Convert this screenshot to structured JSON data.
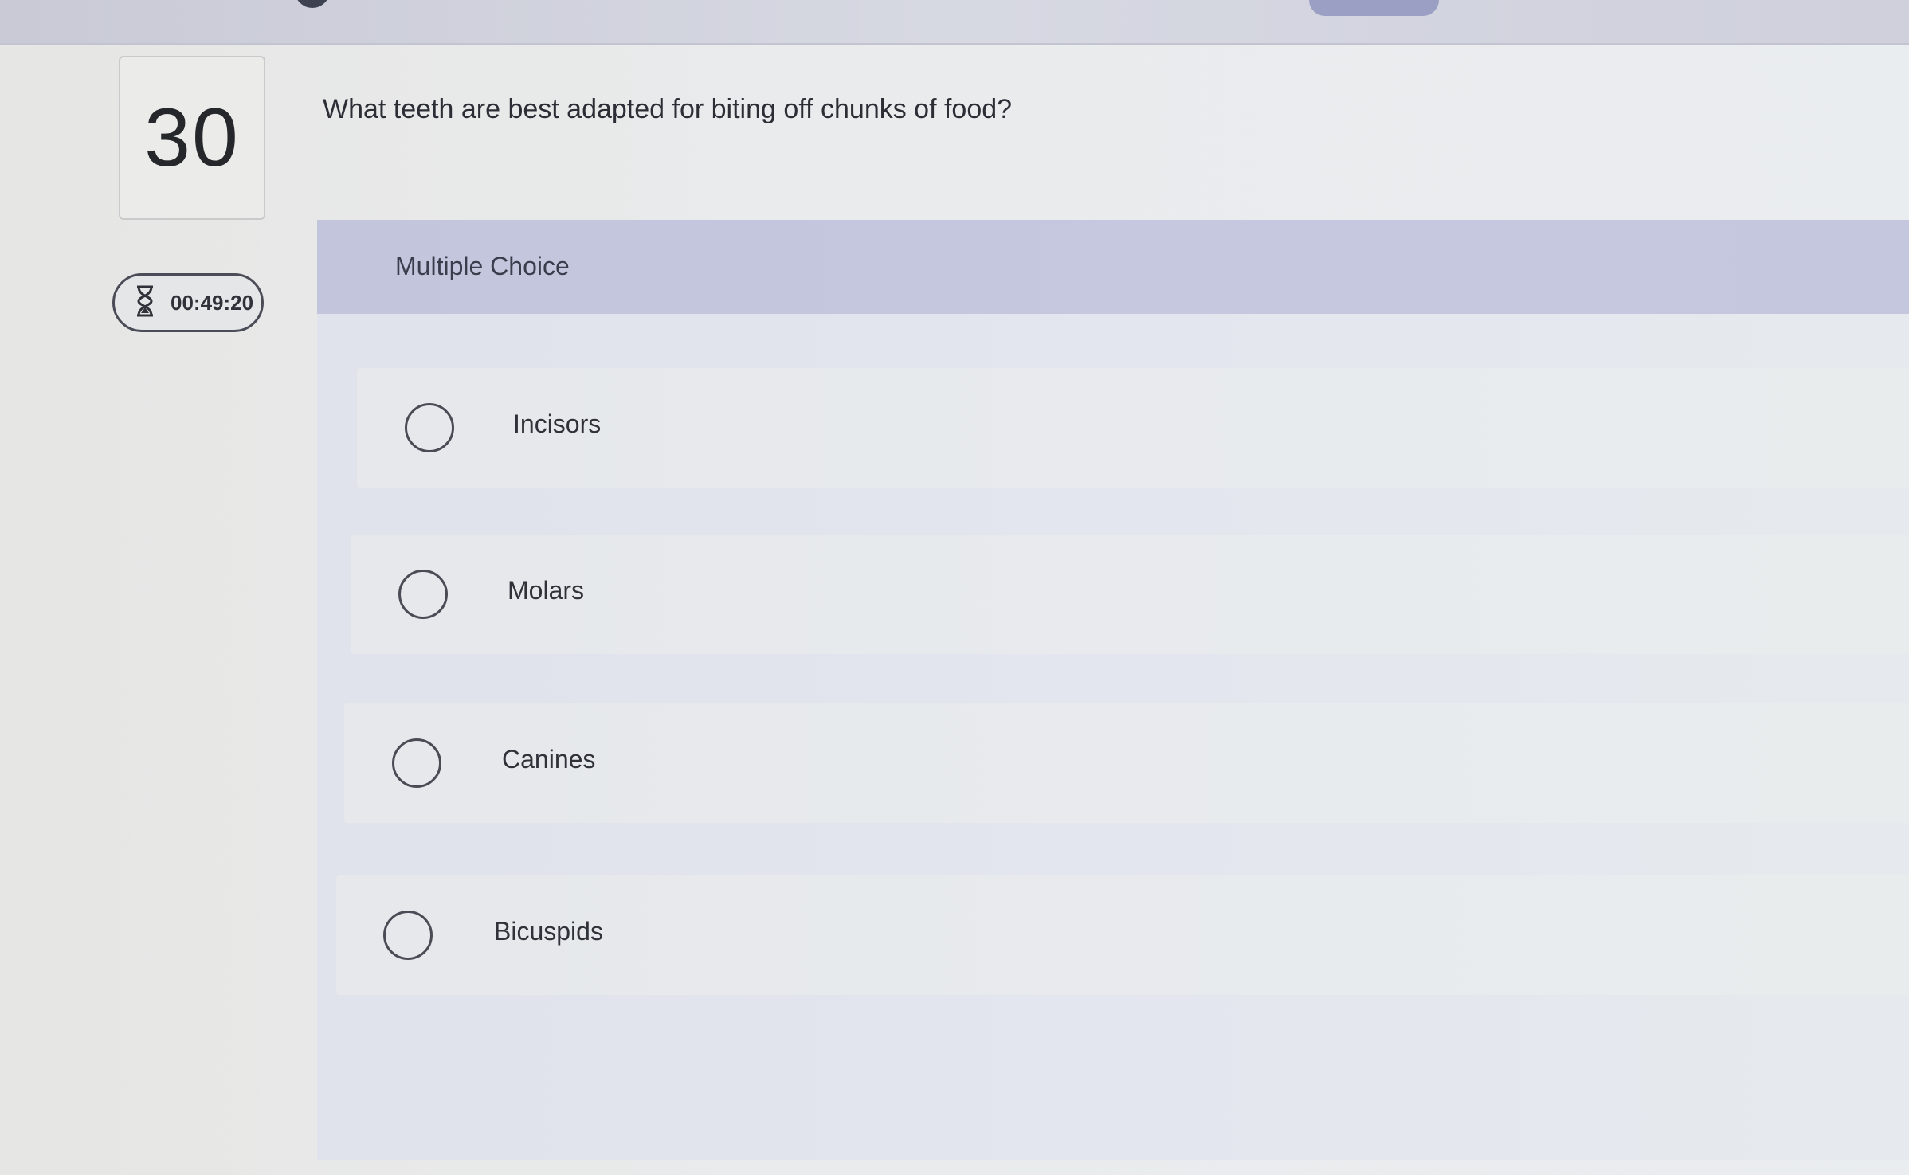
{
  "question": {
    "number": "30",
    "text": "What teeth are best adapted for biting off chunks of food?",
    "timer": "00:49:20",
    "timer_icon": "hourglass-icon"
  },
  "panel": {
    "title": "Multiple Choice"
  },
  "options": [
    {
      "label": "Incisors"
    },
    {
      "label": "Molars"
    },
    {
      "label": "Canines"
    },
    {
      "label": "Bicuspids"
    }
  ]
}
